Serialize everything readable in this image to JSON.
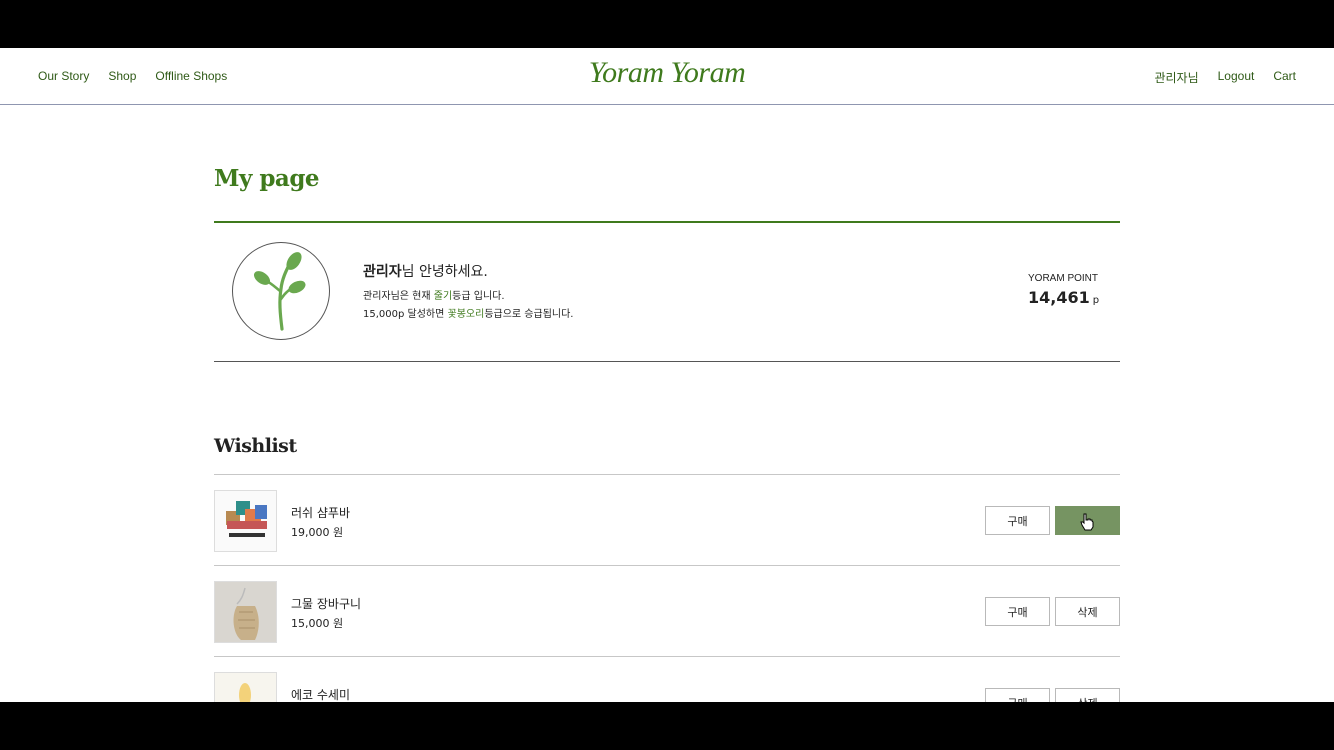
{
  "nav": {
    "left": [
      "Our Story",
      "Shop",
      "Offline Shops"
    ],
    "brand": "Yoram Yoram",
    "right": [
      "관리자님",
      "Logout",
      "Cart"
    ]
  },
  "page": {
    "title": "My page"
  },
  "profile": {
    "greeting_name": "관리자",
    "greeting_rest": "님 안녕하세요.",
    "grade_prefix": "관리자님은 현재 ",
    "grade_name": "줄기",
    "grade_suffix": "등급 입니다.",
    "next_prefix": "15,000p 달성하면 ",
    "next_grade": "꽃봉오리",
    "next_suffix": "등급으로 승급됩니다.",
    "point_label": "YORAM POINT",
    "point_value": "14,461",
    "point_unit": "p",
    "avatar_icon": "sprout-icon"
  },
  "wishlist": {
    "title": "Wishlist",
    "buy_label": "구매",
    "delete_label": "삭제",
    "items": [
      {
        "name": "러쉬 샴푸바",
        "price": "19,000 원"
      },
      {
        "name": "그물 장바구니",
        "price": "15,000 원"
      },
      {
        "name": "에코 수세미",
        "price": ""
      }
    ]
  },
  "colors": {
    "brand_green": "#3f7a1d",
    "hover_button": "#769462"
  }
}
